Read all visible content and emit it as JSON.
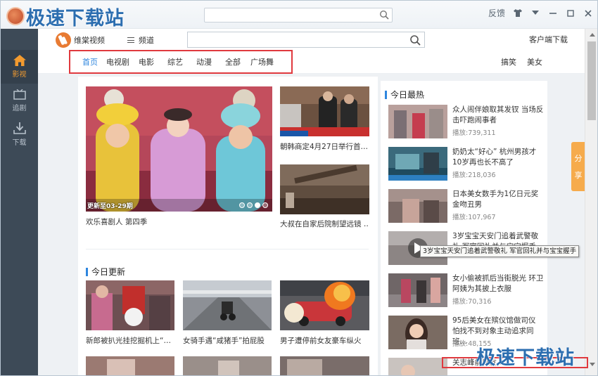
{
  "watermark": {
    "text": "极速下载站"
  },
  "titlebar": {
    "feedback": "反馈"
  },
  "sidebar": {
    "items": [
      {
        "label": "影视",
        "icon": "home-icon"
      },
      {
        "label": "追剧",
        "icon": "tv-icon"
      },
      {
        "label": "下载",
        "icon": "download-icon"
      }
    ]
  },
  "header": {
    "brand": "维棠视频",
    "channel": "频道",
    "client_download": "客户端下载"
  },
  "nav": {
    "tabs": [
      "首页",
      "电视剧",
      "电影",
      "综艺",
      "动漫",
      "全部",
      "广场舞"
    ],
    "active": 0,
    "right": [
      "搞笑",
      "美女"
    ]
  },
  "main": {
    "hero": {
      "badge": "更新至03-29期",
      "caption": "欢乐喜剧人 第四季"
    },
    "side_videos": [
      {
        "caption": "朝韩商定4月27日举行首…"
      },
      {
        "caption": "大叔在自家后院制望远镜 …"
      }
    ],
    "section_title": "今日更新",
    "updates": [
      {
        "caption": "新郎被扒光挂挖掘机上“…"
      },
      {
        "caption": "女骑手遇“咸猪手”拍屁股"
      },
      {
        "caption": "男子遭停前女友豪车纵火"
      }
    ]
  },
  "hot": {
    "title": "今日最热",
    "items": [
      {
        "title": "众人闹伴娘取其发钗 当场反击吓跑闹事者",
        "plays": "播放:739,311"
      },
      {
        "title": "奶奶太“好心” 杭州男孩才10岁再也长不高了",
        "plays": "播放:218,036"
      },
      {
        "title": "日本美女数手为1亿日元奖金吻丑男",
        "plays": "播放:107,967"
      },
      {
        "title": "3岁宝宝天安门追着武警敬礼 军官回礼并与宝宝握手",
        "plays": ""
      },
      {
        "title": "女小偷被抓后当街脱光 环卫阿姨为其披上衣服",
        "plays": "播放:70,316"
      },
      {
        "title": "95后美女在殡仪馆做司仪 怕找不到对象主动追求同班…",
        "plays": "播放:48,155"
      },
      {
        "title": "关志峰前男友…",
        "plays": ""
      }
    ],
    "tooltip": "3岁宝宝天安门追着武警敬礼 军官回礼并与宝宝握手"
  },
  "share": {
    "label1": "分",
    "label2": "享"
  }
}
